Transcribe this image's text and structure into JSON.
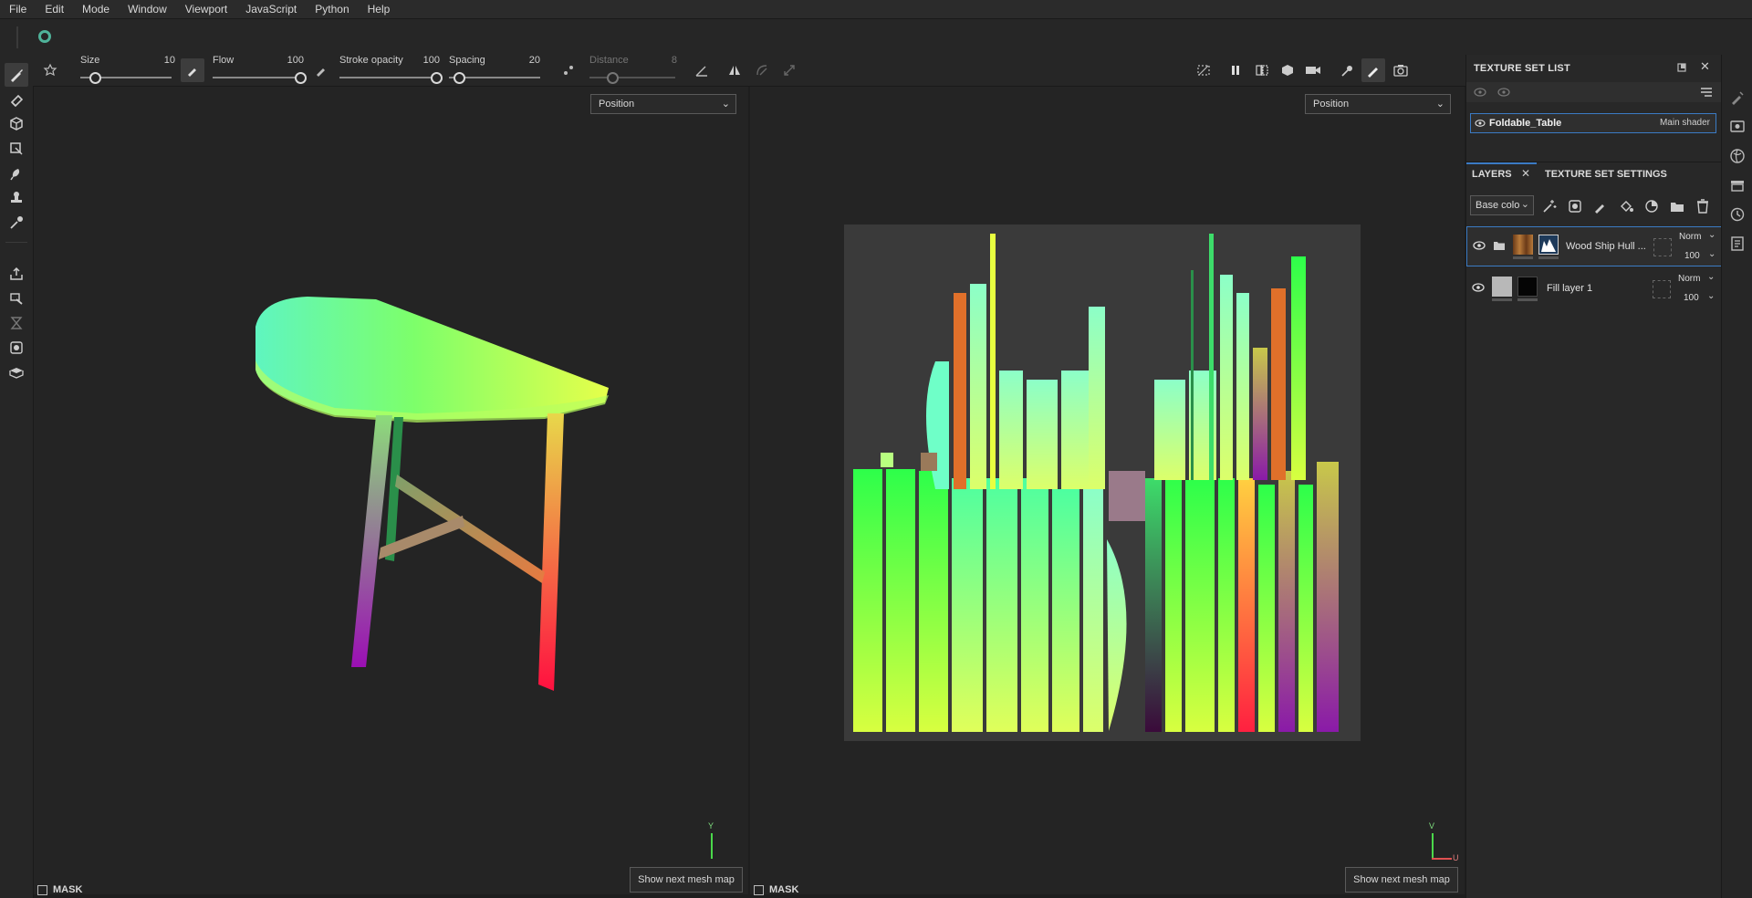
{
  "menu": [
    "File",
    "Edit",
    "Mode",
    "Window",
    "Viewport",
    "JavaScript",
    "Python",
    "Help"
  ],
  "tool_options": {
    "size_label": "Size",
    "size_value": "10",
    "size_level": 0.1,
    "flow_label": "Flow",
    "flow_value": "100",
    "flow_level": 1.0,
    "stroke_opacity_label": "Stroke opacity",
    "stroke_opacity_value": "100",
    "stroke_opacity_level": 1.0,
    "spacing_label": "Spacing",
    "spacing_value": "20",
    "spacing_level": 0.05,
    "distance_label": "Distance",
    "distance_value": "8",
    "distance_level": 0.2
  },
  "viewport_3d": {
    "channel_select": "Position",
    "mask_label": "MASK",
    "next_button": "Show next mesh map",
    "axis_label": "Y"
  },
  "viewport_2d": {
    "channel_select": "Position",
    "mask_label": "MASK",
    "next_button": "Show next mesh map",
    "axis_label": "V",
    "axis_label_u": "U"
  },
  "texture_set_list": {
    "title": "TEXTURE SET LIST",
    "item_name": "Foldable_Table",
    "item_shader": "Main shader"
  },
  "layers_panel": {
    "tab_layers": "LAYERS",
    "tab_settings": "TEXTURE SET SETTINGS",
    "channel_select": "Base colo",
    "layers": [
      {
        "name": "Wood Ship Hull ...",
        "blend": "Norm",
        "opacity": "100"
      },
      {
        "name": "Fill layer 1",
        "blend": "Norm",
        "opacity": "100"
      }
    ]
  },
  "colors": {
    "accent": "#3b7bc4",
    "app_logo": "#4fb39a",
    "background": "#1e1e1e"
  }
}
